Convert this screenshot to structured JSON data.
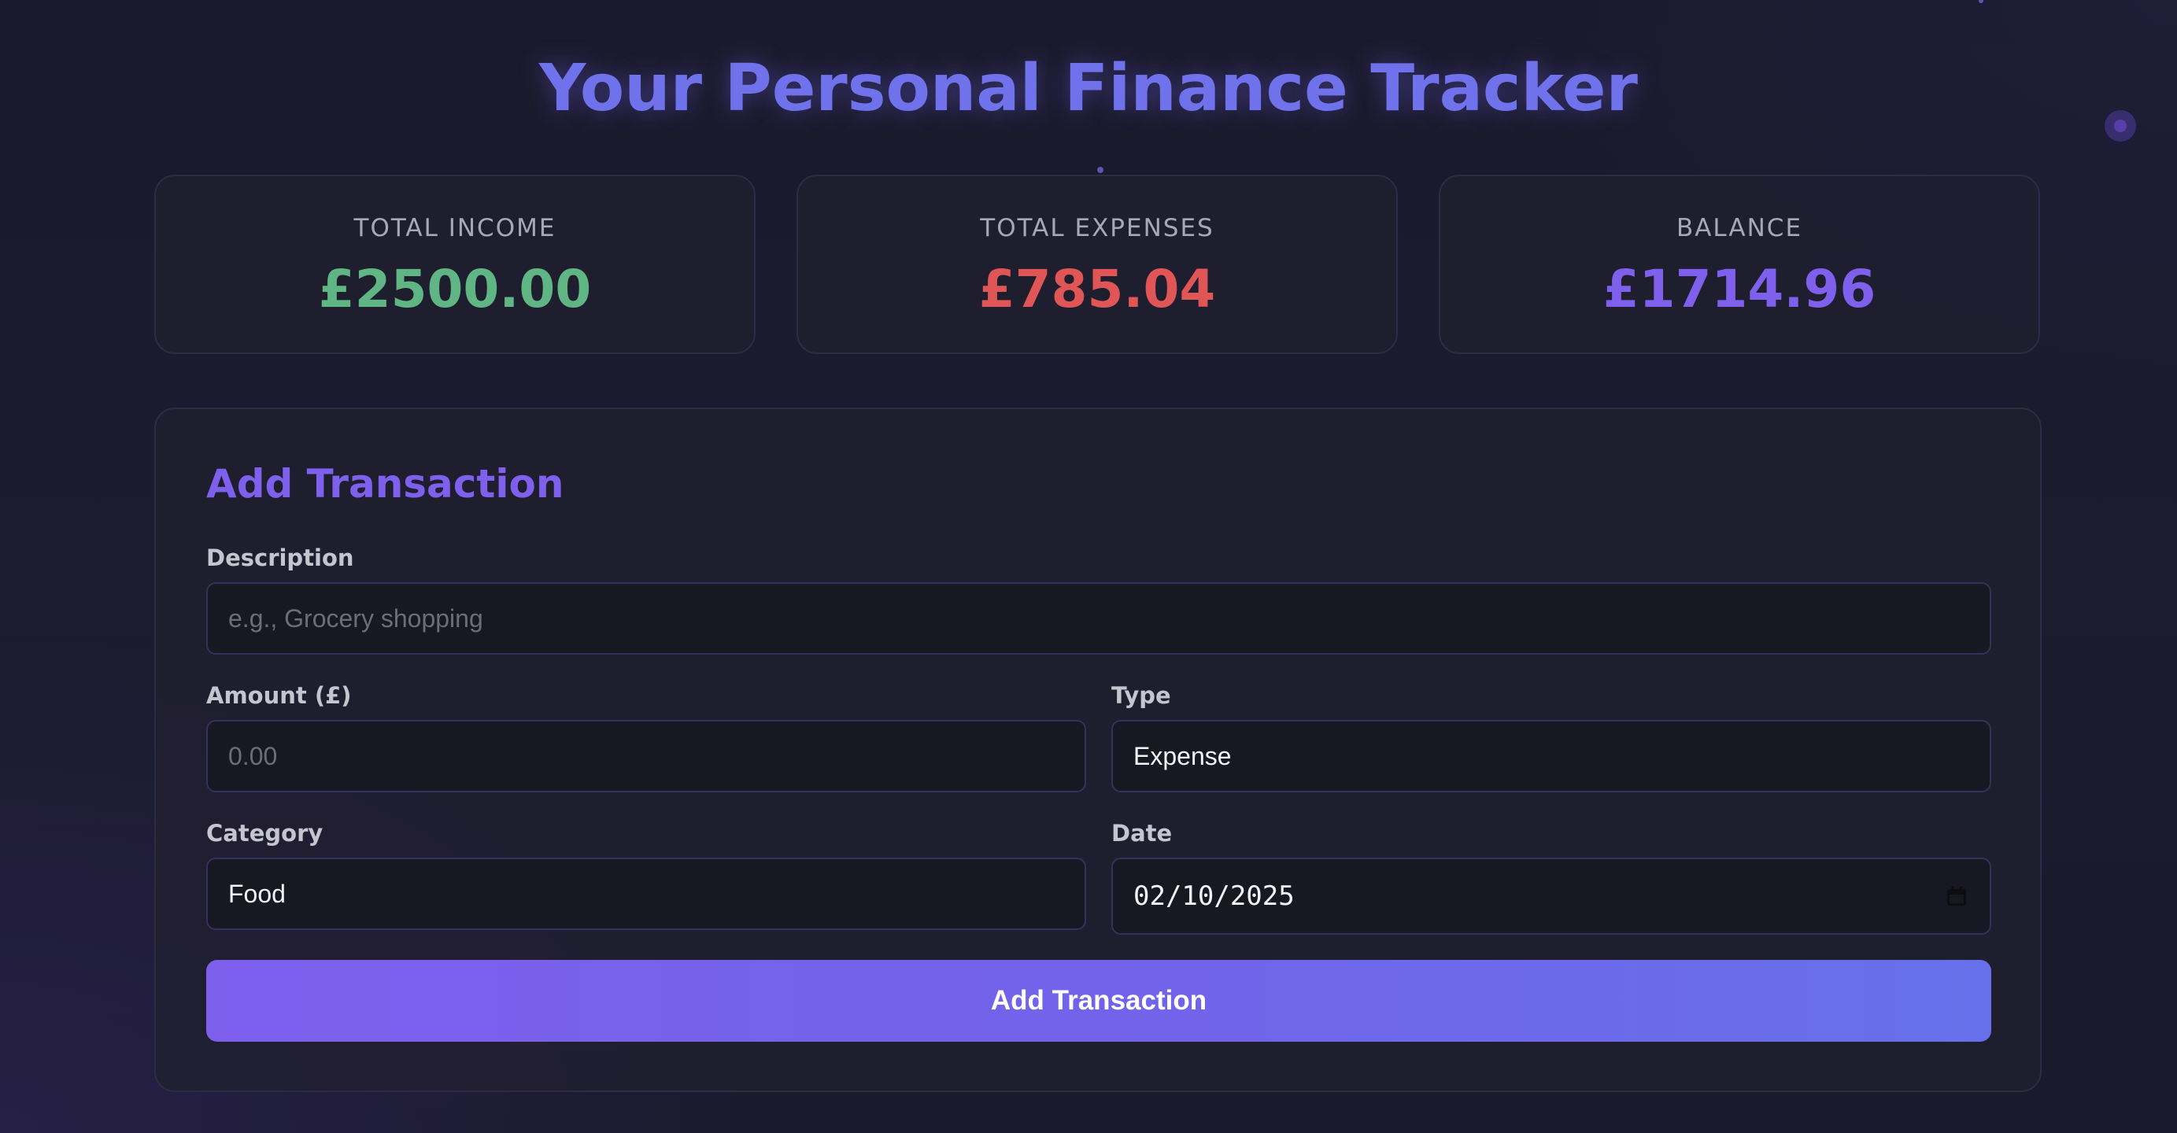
{
  "header": {
    "title": "Your Personal Finance Tracker"
  },
  "summary": {
    "income": {
      "label": "TOTAL INCOME",
      "value": "£2500.00",
      "color": "#5fb584"
    },
    "expenses": {
      "label": "TOTAL EXPENSES",
      "value": "£785.04",
      "color": "#e05555"
    },
    "balance": {
      "label": "BALANCE",
      "value": "£1714.96",
      "color": "#7e60ec"
    }
  },
  "form": {
    "title": "Add Transaction",
    "description": {
      "label": "Description",
      "placeholder": "e.g., Grocery shopping",
      "value": ""
    },
    "amount": {
      "label": "Amount (£)",
      "placeholder": "0.00",
      "value": ""
    },
    "type": {
      "label": "Type",
      "value": "Expense"
    },
    "category": {
      "label": "Category",
      "value": "Food"
    },
    "date": {
      "label": "Date",
      "value": "02/10/2025",
      "icon": "calendar-icon"
    },
    "submit_label": "Add Transaction"
  },
  "theme": {
    "accent": "#7e60ec",
    "title_color": "#6f72ea",
    "background": "#1c1b2f"
  }
}
